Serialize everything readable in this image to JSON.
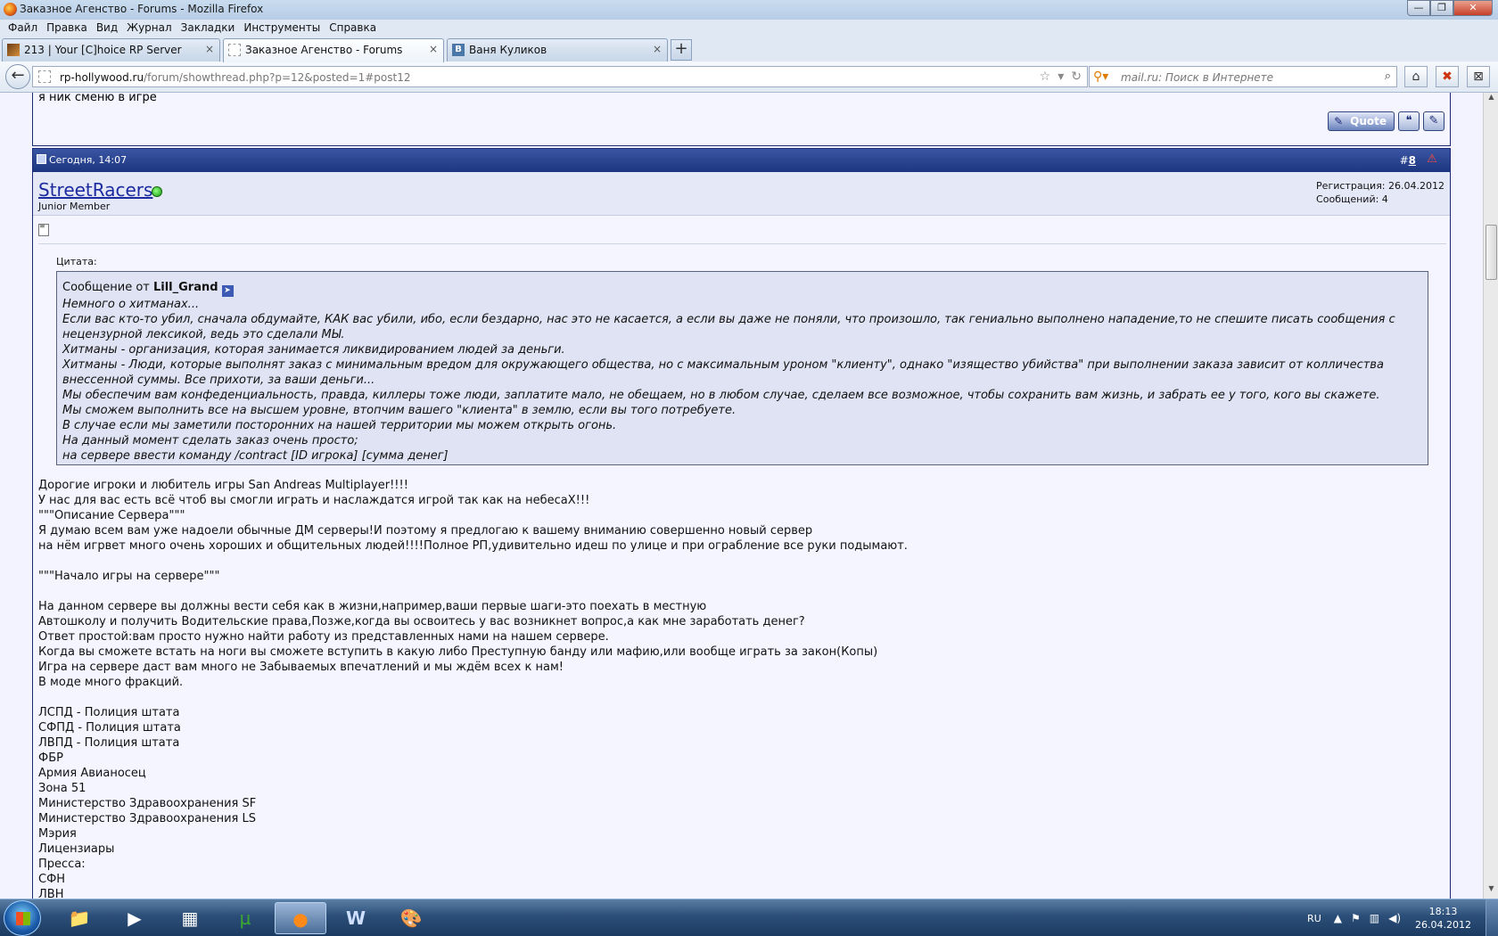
{
  "window": {
    "title": "Заказное Агенство - Forums - Mozilla Firefox",
    "buttons": {
      "minimize": "—",
      "maximize": "❐",
      "close": "✕"
    }
  },
  "menu": [
    "Файл",
    "Правка",
    "Вид",
    "Журнал",
    "Закладки",
    "Инструменты",
    "Справка"
  ],
  "tabs": [
    {
      "label": "213 | Your [C]hoice RP Server",
      "close": "×"
    },
    {
      "label": "Заказное Агенство - Forums",
      "close": "×"
    },
    {
      "label": "Ваня Куликов",
      "close": "×"
    }
  ],
  "newtab": "+",
  "navbar": {
    "back": "←",
    "url_domain": "rp-hollywood.ru",
    "url_path": "/forum/showthread.php?p=12&posted=1#post12",
    "search_placeholder": "mail.ru: Поиск в Интернете"
  },
  "prev_post": {
    "last_line": "я ник сменю в игре",
    "quote_button": "Quote"
  },
  "post": {
    "date": "Сегодня, 14:07",
    "number_prefix": "#",
    "number": "8",
    "username": "StreetRacers",
    "user_title": "Junior Member",
    "registration": "Регистрация: 26.04.2012",
    "messages": "Сообщений: 4",
    "quote_label": "Цитата:",
    "quote_from_prefix": "Сообщение от ",
    "quote_author": "Lill_Grand",
    "quote_lines": [
      "Немного о хитманах...",
      "Если вас кто-то убил, сначала обдумайте, КАК вас убили, ибо, если бездарно, нас это не касается, а если вы даже не поняли, что произошло, так гениально выполнено нападение,то не спешите писать сообщения с нецензурной лексикой, ведь это сделали МЫ.",
      "Хитманы - организация, которая занимается ликвидированием людей за деньги.",
      "Хитманы - Люди, которые выполнят заказ с минимальным вредом для окружающего общества, но с максимальным уроном \"клиенту\", однако \"изящество убийства\" при выполнении заказа зависит от колличества внессенной суммы. Все прихоти, за ваши деньги...",
      "Мы обеспечим вам конфеденциальность, правда, киллеры тоже люди, заплатите мало, не обещаем, но в любом случае, сделаем все возможное, чтобы сохранить вам жизнь, и забрать ее у того, кого вы скажете.",
      "Мы сможем выполнить все на высшем уровне, втопчим вашего \"клиента\" в землю, если вы того потребуете.",
      "В случае если мы заметили посторонних на нашей территории мы можем открыть огонь.",
      "На данный момент сделать заказ очень просто;",
      "на сервере ввести команду /contract [ID игрока] [сумма денег]"
    ],
    "body_lines": [
      "Дорогие игроки и любитель игры San Andreas Multiplayer!!!!",
      "У нас для вас есть всё чтоб вы смогли играть и наслаждатся игрой так как на небесаХ!!!",
      "\"\"\"Описание Сервера\"\"\"",
      "Я думаю всем вам уже надоели обычные ДМ серверы!И поэтому я предлогаю к вашему вниманию совершенно новый сервер",
      "на нём игрвет много очень хороших и общительных людей!!!!Полное РП,удивительно идеш по улице и при ограбление все руки подымают.",
      "",
      "\"\"\"Начало игры на сервере\"\"\"",
      "",
      "На данном сервере вы должны вести себя как в жизни,например,ваши первые шаги-это поехать в местную",
      "Автошколу и получить Водительские права,Позже,когда вы освоитесь у вас возникнет вопрос,а как мне заработать денег?",
      "Ответ простой:вам просто нужно найти работу из представленных нами на нашем сервере.",
      "Когда вы сможете встать на ноги вы сможете вступить в какую либо Преступную банду или мафию,или вообще играть за закон(Копы)",
      "Игра на сервере даст вам много не Забываемых впечатлений и мы ждём всех к нам!",
      "В моде много фракций.",
      "",
      "ЛСПД - Полиция штата",
      "СФПД - Полиция штата",
      "ЛВПД - Полиция штата",
      "ФБР",
      "Армия Авианосец",
      "Зона 51",
      "Министерство Здравоохранения SF",
      "Министерство Здравоохранения LS",
      "Мэрия",
      "Лицензиары",
      "Пресса:",
      "СФН",
      "ЛВН"
    ]
  },
  "taskbar": {
    "language": "RU",
    "time": "18:13",
    "date": "26.04.2012",
    "apps": [
      "folder-icon",
      "media-player-icon",
      "calculator-icon",
      "utorrent-icon",
      "firefox-icon",
      "word-icon",
      "paint-icon"
    ]
  }
}
